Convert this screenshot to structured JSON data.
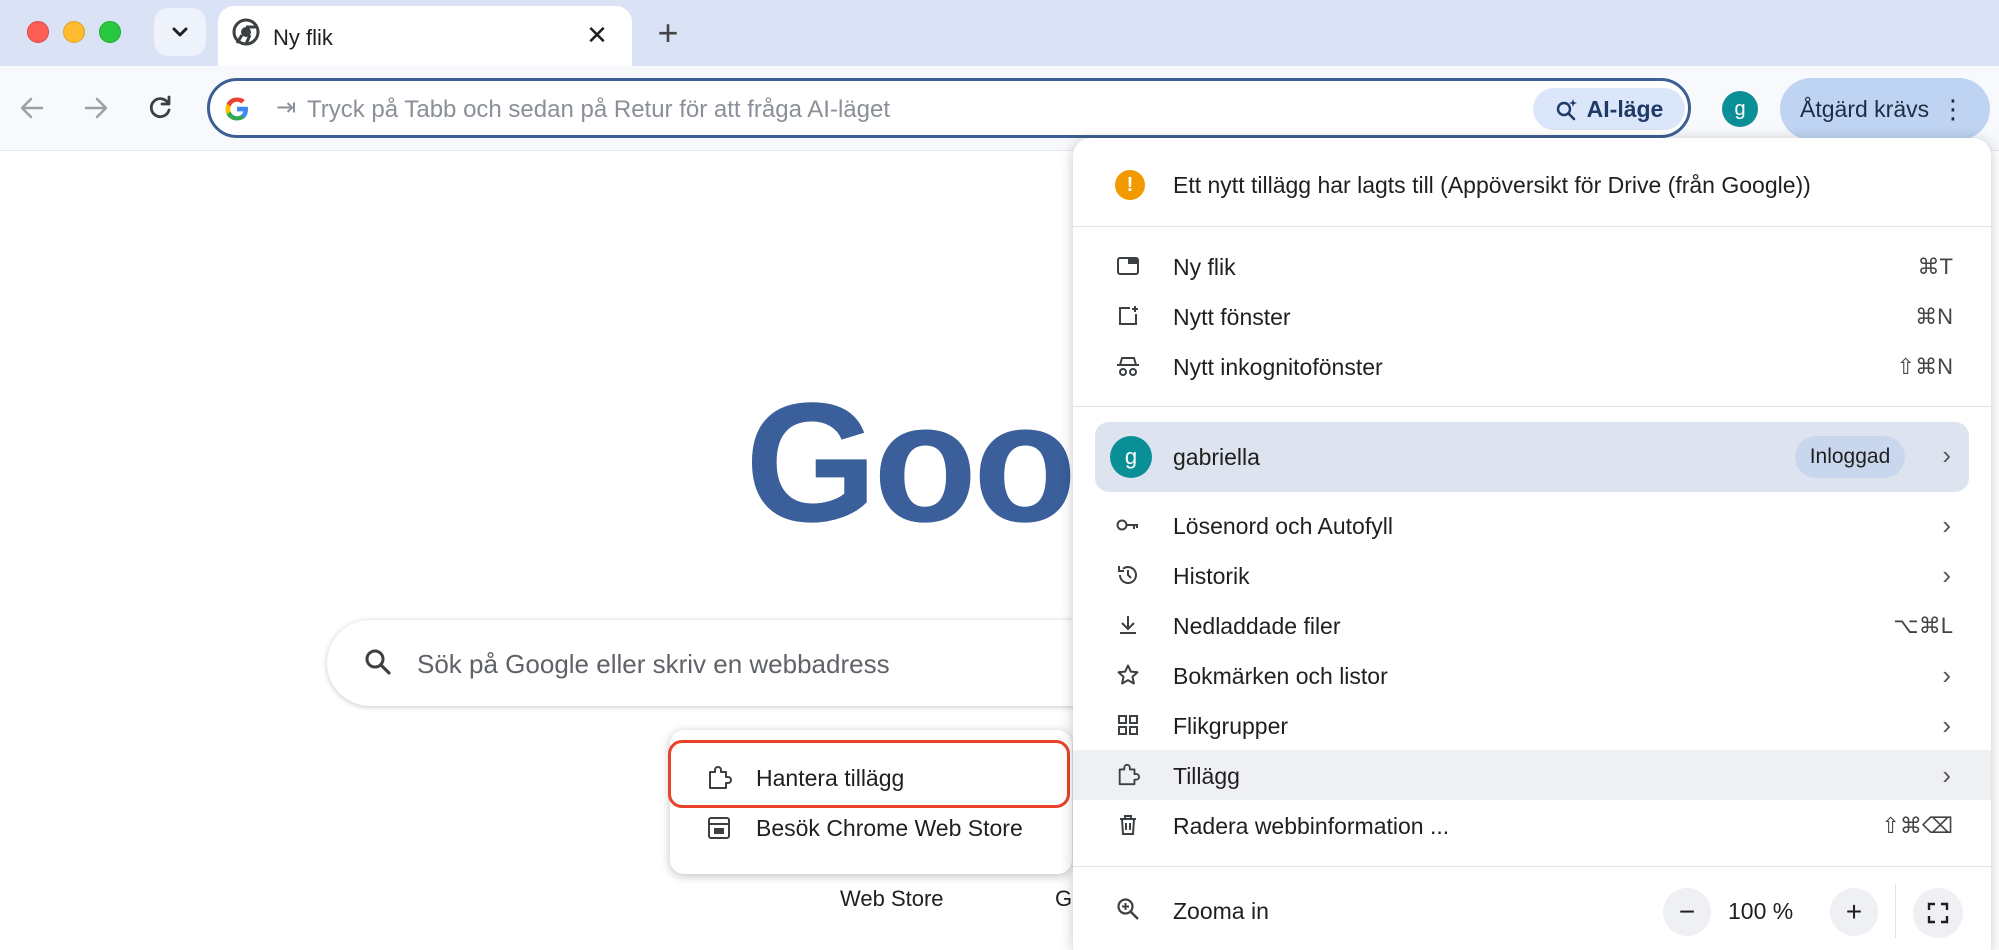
{
  "tab": {
    "title": "Ny flik",
    "close": "✕",
    "new_tab": "+"
  },
  "omnibox": {
    "tab_hint": "⇥",
    "placeholder": "Tryck på Tabb och sedan på Retur för att fråga AI-läget",
    "ai_mode_label": "AI-läge"
  },
  "toolbar": {
    "profile_initial": "g",
    "action_label": "Åtgärd krävs",
    "menu_dots": "⋮"
  },
  "page": {
    "logo_text": "Goog",
    "search_placeholder": "Sök på Google eller skriv en webbadress",
    "shortcut_labels": [
      "Web Store",
      "G"
    ]
  },
  "submenu": {
    "items": [
      {
        "label": "Hantera tillägg",
        "icon": "puzzle-icon"
      },
      {
        "label": "Besök Chrome Web Store",
        "icon": "web-store-icon"
      }
    ]
  },
  "menu": {
    "notice": "Ett nytt tillägg har lagts till (Appöversikt för Drive (från Google))",
    "notice_icon": "!",
    "group1": [
      {
        "label": "Ny flik",
        "shortcut": "⌘T",
        "icon": "new-tab-icon"
      },
      {
        "label": "Nytt fönster",
        "shortcut": "⌘N",
        "icon": "new-window-icon"
      },
      {
        "label": "Nytt inkognitofönster",
        "shortcut": "⇧⌘N",
        "icon": "incognito-icon"
      }
    ],
    "profile": {
      "initial": "g",
      "name": "gabriella",
      "status": "Inloggad"
    },
    "group2": [
      {
        "label": "Lösenord och Autofyll",
        "shortcut": "",
        "icon": "key-icon",
        "chevron": true
      },
      {
        "label": "Historik",
        "shortcut": "",
        "icon": "history-icon",
        "chevron": true
      },
      {
        "label": "Nedladdade filer",
        "shortcut": "⌥⌘L",
        "icon": "download-icon",
        "chevron": false
      },
      {
        "label": "Bokmärken och listor",
        "shortcut": "",
        "icon": "star-icon",
        "chevron": true
      },
      {
        "label": "Flikgrupper",
        "shortcut": "",
        "icon": "grid-icon",
        "chevron": true
      },
      {
        "label": "Tillägg",
        "shortcut": "",
        "icon": "puzzle-icon",
        "chevron": true
      },
      {
        "label": "Radera webbinformation ...",
        "shortcut": "⇧⌘⌫",
        "icon": "trash-icon",
        "chevron": false
      }
    ],
    "chevron": "›",
    "zoom": {
      "label": "Zooma in",
      "value": "100 %",
      "minus": "−",
      "plus": "+"
    }
  },
  "colors": {
    "tabstrip_bg": "#d9e3f5",
    "omnibox_border": "#3e5f93",
    "action_button_bg": "#bfd4f2",
    "profile_avatar": "#0b8f96",
    "highlight_border": "#e8432a",
    "warning": "#f29900"
  }
}
